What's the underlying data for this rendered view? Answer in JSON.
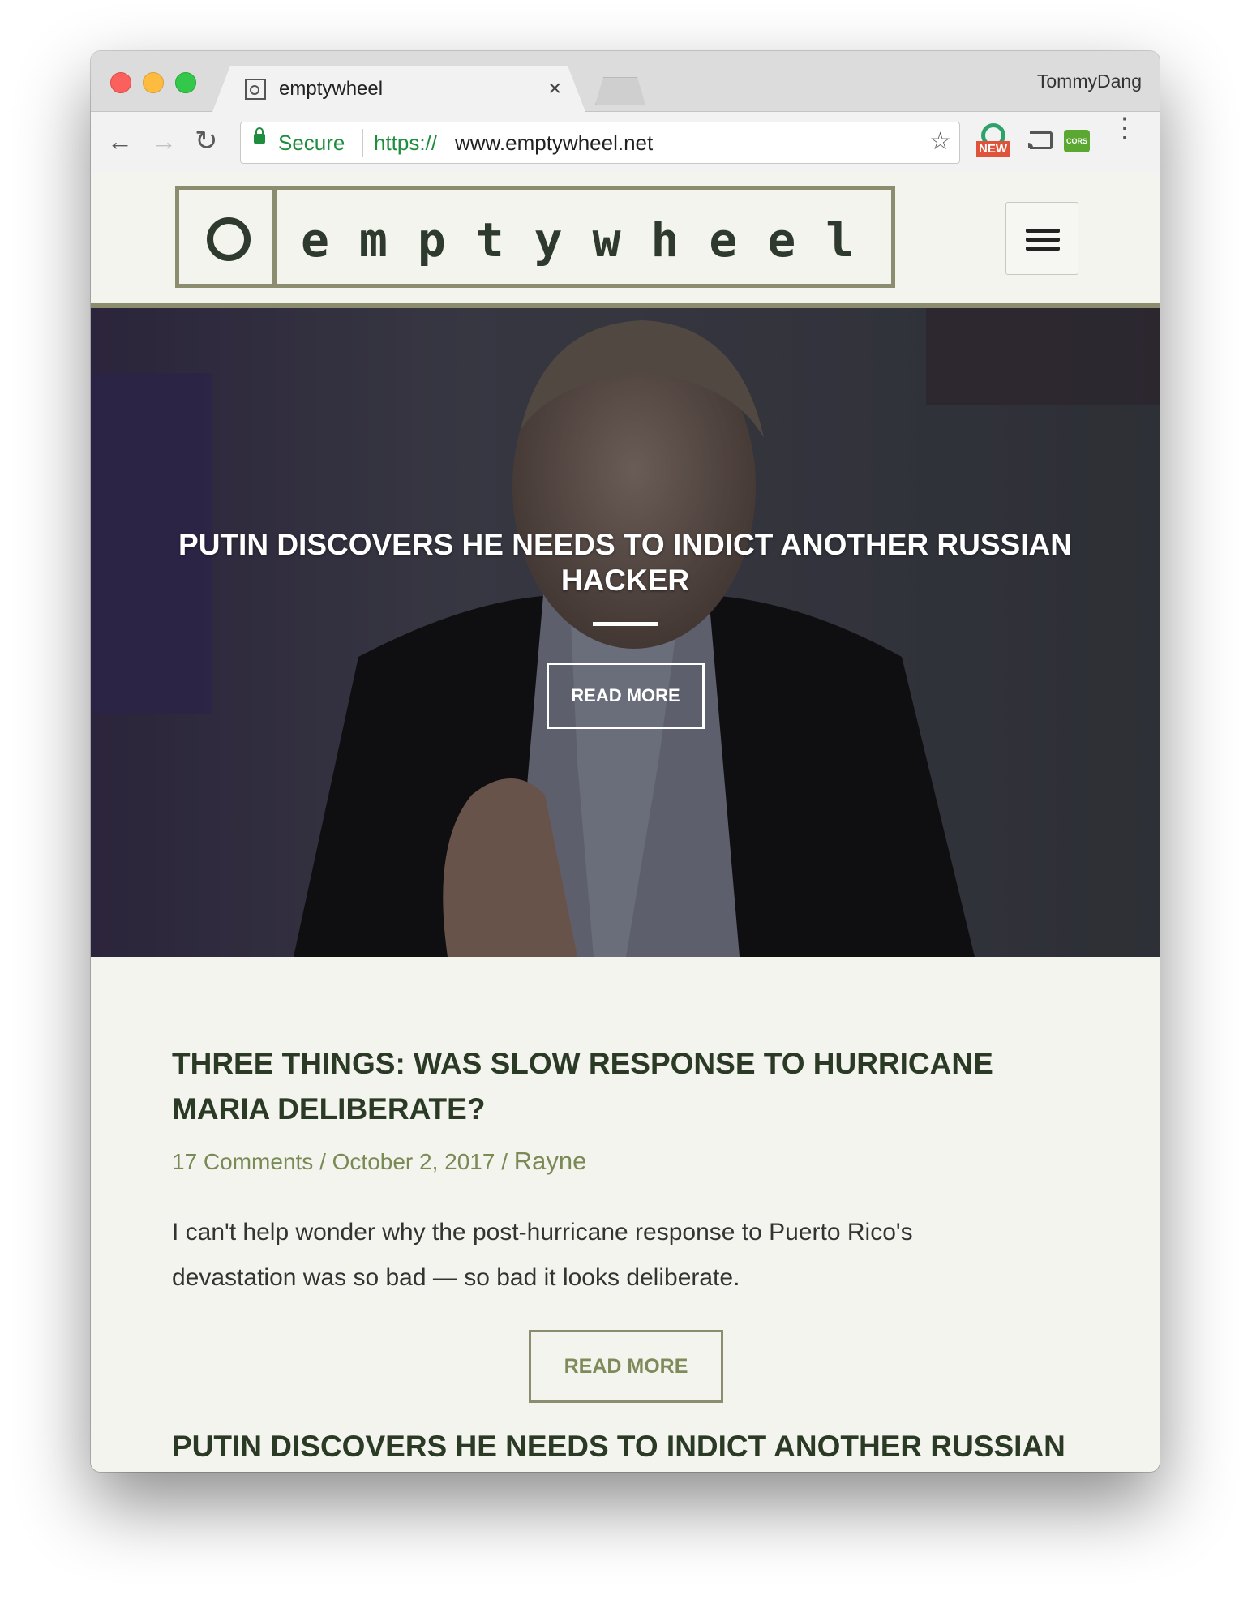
{
  "browser": {
    "tab_title": "emptywheel",
    "tab_close": "×",
    "profile_name": "TommyDang",
    "secure_label": "Secure",
    "url_scheme": "https://",
    "url_host": "www.emptywheel.net",
    "extension_badge": "NEW",
    "cors_label": "CORS",
    "icons": [
      "back-icon",
      "forward-icon",
      "reload-icon",
      "lock-icon",
      "star-icon",
      "cast-icon",
      "menu-icon"
    ]
  },
  "site": {
    "logo_text": "emptywheel",
    "accent_color": "#8b8d6e"
  },
  "hero": {
    "title": "PUTIN DISCOVERS HE NEEDS TO INDICT ANOTHER RUSSIAN HACKER",
    "button_label": "READ MORE"
  },
  "post": {
    "title": "THREE THINGS: WAS SLOW RESPONSE TO HURRICANE MARIA DELIBERATE?",
    "comments": "17 Comments",
    "separator": " / ",
    "date": "October 2, 2017",
    "author": "Rayne",
    "excerpt": "I can't help wonder why the post-hurricane response to Puerto Rico's devastation was so bad — so bad it looks deliberate.",
    "button_label": "READ MORE"
  },
  "next_post": {
    "title": "PUTIN DISCOVERS HE NEEDS TO INDICT ANOTHER RUSSIAN"
  }
}
